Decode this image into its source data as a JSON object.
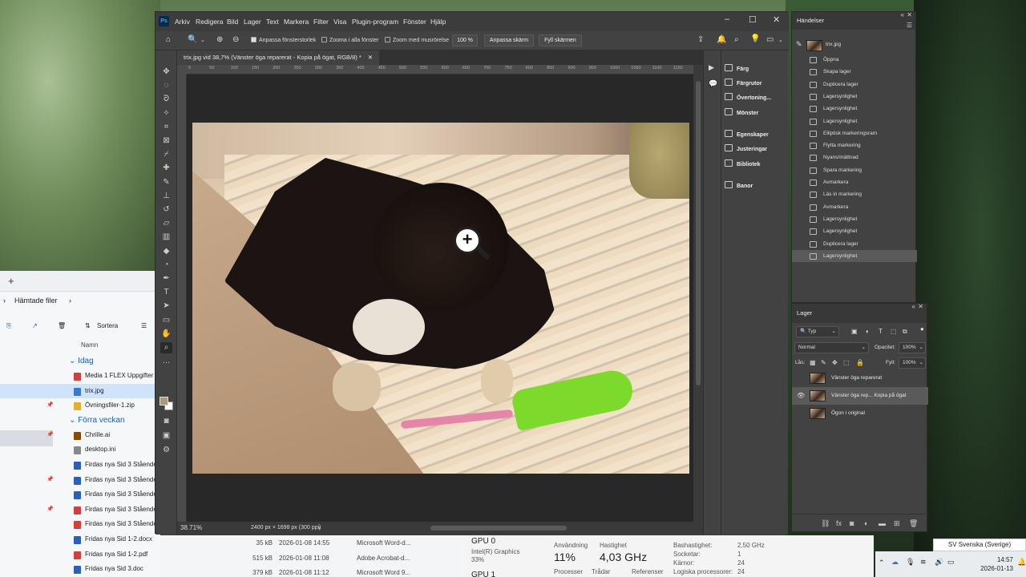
{
  "photoshop": {
    "logo": "Ps",
    "menu": [
      "Arkiv",
      "Redigera",
      "Bild",
      "Lager",
      "Text",
      "Markera",
      "Filter",
      "Visa",
      "Plugin-program",
      "Fönster",
      "Hjälp"
    ],
    "options": {
      "resize_windows": "Anpassa fönsterstorlek",
      "zoom_all_windows": "Zooma i alla fönster",
      "scrubby_zoom": "Zoom med musrörelse",
      "zoom_value": "100 %",
      "fit_screen": "Anpassa skärm",
      "fill_screen": "Fyll skärmen"
    },
    "doc_tab": "trix.jpg vid 38,7% (Vänster öga reparerat - Kopia på ögat, RGB/8) *",
    "ruler_ticks": [
      "0",
      "50",
      "100",
      "150",
      "200",
      "250",
      "300",
      "350",
      "400",
      "450",
      "500",
      "550",
      "600",
      "650",
      "700",
      "750",
      "800",
      "850",
      "900",
      "950",
      "1000",
      "1050",
      "1100",
      "1150",
      "1200"
    ],
    "status": {
      "zoom": "38.71%",
      "size": "2400 px × 1698 px (300 ppi)"
    },
    "dock": [
      "Färg",
      "Färgrutor",
      "Övertoning...",
      "Mönster",
      "Egenskaper",
      "Justeringar",
      "Bibliotek",
      "Banor"
    ]
  },
  "history": {
    "title": "Händelser",
    "snapshot": "trix.jpg",
    "items": [
      "Öppna",
      "Skapa lager",
      "Duplicera lager",
      "Lagersynlighet",
      "Lagersynlighet",
      "Lagersynlighet",
      "Elliptisk markeringsram",
      "Flytta markering",
      "Nyans/mättnad",
      "Spara markering",
      "Avmarkera",
      "Läs in markering",
      "Avmarkera",
      "Lagersynlighet",
      "Lagersynlighet",
      "Duplicera lager",
      "Lagersynlighet"
    ]
  },
  "layers": {
    "title": "Lager",
    "filter": "Typ",
    "blend": "Normal",
    "opacity_label": "Opacitet:",
    "opacity": "100%",
    "lock_label": "Lås:",
    "fill_label": "Fyll:",
    "fill": "100%",
    "items": [
      {
        "name": "Vänster öga reparerat",
        "visible": false
      },
      {
        "name": "Vänster öga rep... Kopia på ögat",
        "visible": true
      },
      {
        "name": "Ögon i original",
        "visible": false
      }
    ]
  },
  "explorer": {
    "path": "Hämtade filer",
    "sort": "Sortera",
    "col_name": "Namn",
    "group_today": "Idag",
    "group_prev": "Förra veckan",
    "today_files": [
      {
        "name": "Media 1 FLEX Uppgifter",
        "color": "#d04040"
      },
      {
        "name": "trix.jpg",
        "color": "#3a78c8"
      },
      {
        "name": "Övningsfiler-1.zip",
        "color": "#e0b030"
      }
    ],
    "prev_files": [
      {
        "name": "Chrille.ai",
        "color": "#8a4a00"
      },
      {
        "name": "desktop.ini",
        "color": "#888888"
      },
      {
        "name": "Firdas nya Sid 3 Stående",
        "color": "#2b5fb8"
      },
      {
        "name": "Firdas nya Sid 3 Stående",
        "color": "#2b5fb8"
      },
      {
        "name": "Firdas nya Sid 3 Stående",
        "color": "#2b5fb8"
      },
      {
        "name": "Firdas nya Sid 3 Stående",
        "color": "#d04040"
      },
      {
        "name": "Firdas nya Sid 3 Stående",
        "color": "#d04040"
      },
      {
        "name": "Fridas nya Sid 1-2.docx",
        "color": "#2b5fb8"
      },
      {
        "name": "Fridas nya Sid 1-2.pdf",
        "color": "#d04040"
      },
      {
        "name": "Fridas nya Sid 3.doc",
        "color": "#2b5fb8"
      }
    ],
    "details": [
      {
        "size": "35 kB",
        "date": "2026-01-08 14:55",
        "type": "Microsoft Word-d..."
      },
      {
        "size": "515 kB",
        "date": "2026-01-08 11:08",
        "type": "Adobe Acrobat-d..."
      },
      {
        "size": "379 kB",
        "date": "2026-01-08 11:12",
        "type": "Microsoft Word 9..."
      }
    ]
  },
  "taskmanager": {
    "gpu0": "GPU 0",
    "gpu0_sub": "Intel(R) Graphics",
    "gpu0_pct": "33%",
    "gpu1": "GPU 1",
    "usage_label": "Användning",
    "usage": "11%",
    "speed_label": "Hastighet",
    "speed": "4,03 GHz",
    "proc_label": "Processer",
    "threads_label": "Trådar",
    "refs_label": "Referenser",
    "base_speed_label": "Bashastighet:",
    "base_speed": "2,50 GHz",
    "sockets_label": "Socketar:",
    "sockets": "1",
    "cores_label": "Kärnor:",
    "cores": "24",
    "logical_label": "Logiska processorer:",
    "logical": "24"
  },
  "taskbar": {
    "language": "SV Svenska (Sverige)",
    "time": "14:57",
    "date": "2026-01-13"
  }
}
